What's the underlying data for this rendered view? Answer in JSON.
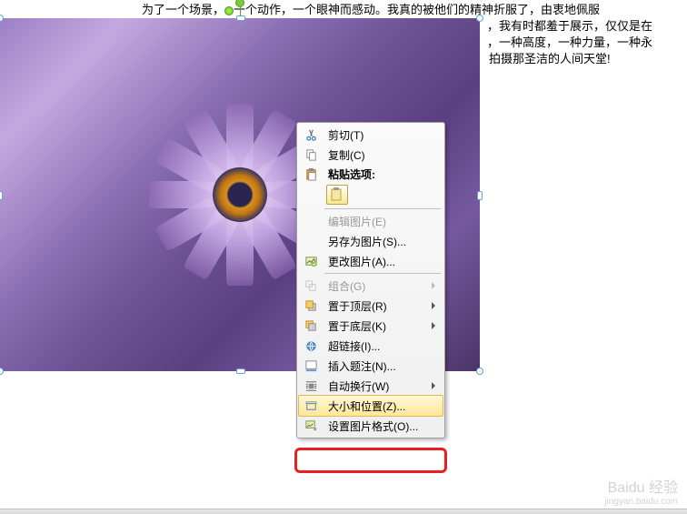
{
  "document": {
    "line1_a": "为了一个场景，",
    "line1_b": "一个动作，一个眼神而感动。我真的被他们的精神折服了，由衷地佩服",
    "line2": "，我有时都羞于展示，仅仅是在",
    "line3": "，一种高度，一种力量，一种永",
    "line4": "拍摄那圣洁的人间天堂!"
  },
  "menu": {
    "cut": "剪切(T)",
    "copy": "复制(C)",
    "paste_label": "粘贴选项:",
    "edit_picture": "编辑图片(E)",
    "save_as_picture": "另存为图片(S)...",
    "change_picture": "更改图片(A)...",
    "group": "组合(G)",
    "bring_front": "置于顶层(R)",
    "send_back": "置于底层(K)",
    "hyperlink": "超链接(I)...",
    "insert_caption": "插入题注(N)...",
    "auto_wrap": "自动换行(W)",
    "size_position": "大小和位置(Z)...",
    "format_picture": "设置图片格式(O)..."
  },
  "watermark": {
    "main": "Baidu 经验",
    "sub": "jingyan.baidu.com"
  }
}
